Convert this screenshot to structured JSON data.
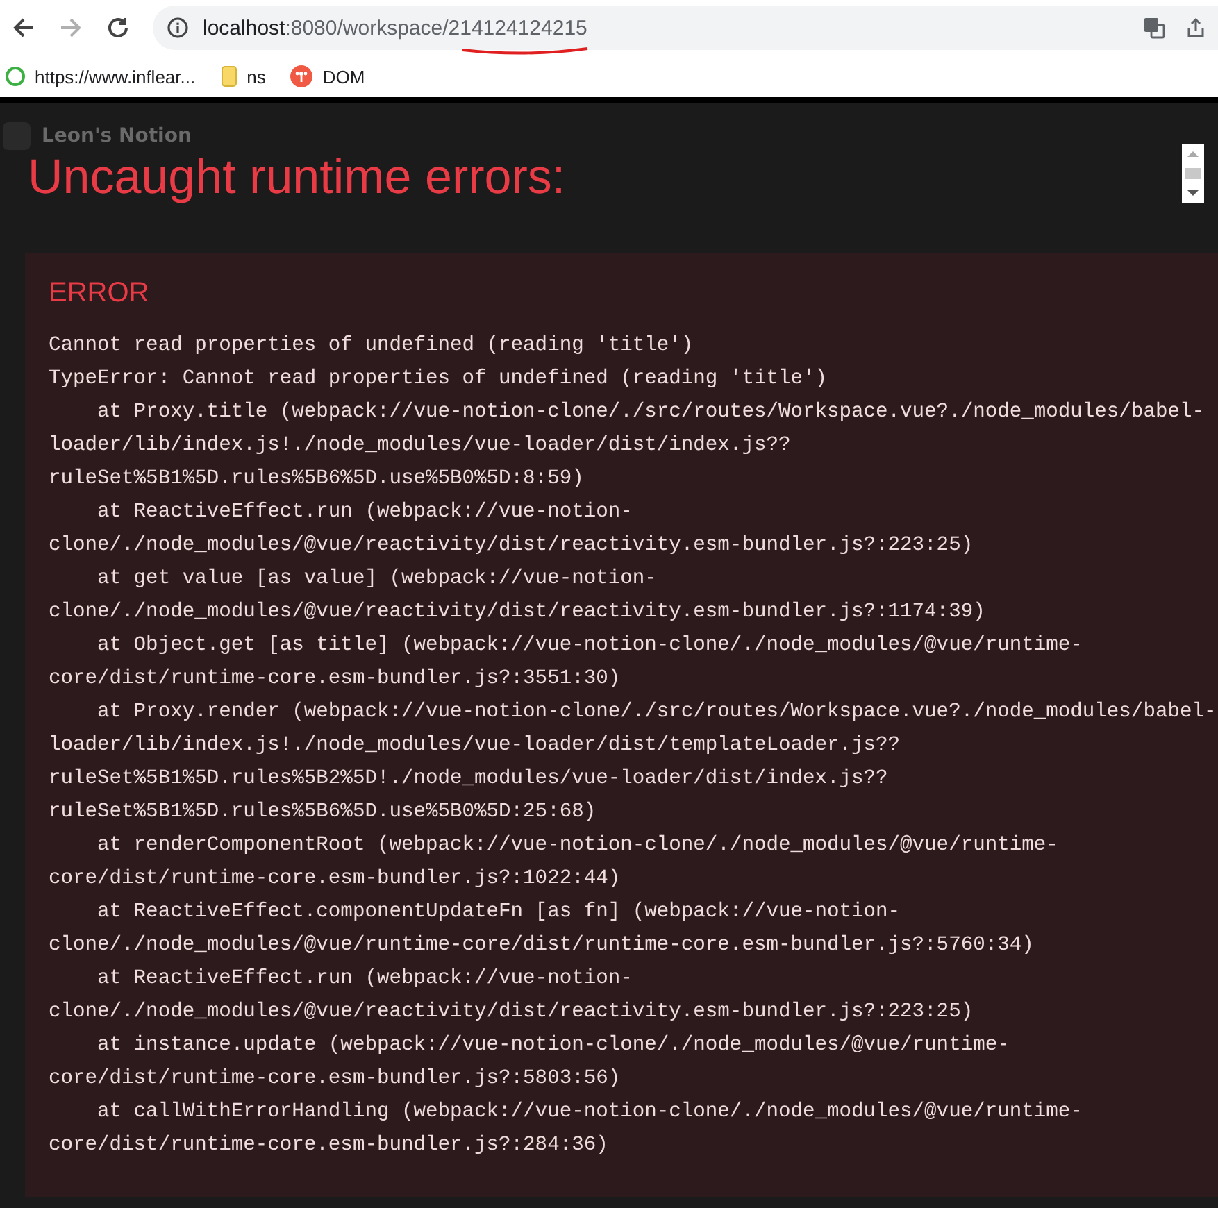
{
  "browser": {
    "nav": {
      "back_disabled": false,
      "forward_disabled": true
    },
    "url": {
      "host": "localhost",
      "rest": ":8080/workspace/",
      "highlight": "214124124215"
    },
    "bookmarks": [
      {
        "kind": "site",
        "label": "https://www.inflear..."
      },
      {
        "kind": "folder",
        "label": "ns"
      },
      {
        "kind": "app",
        "label": "DOM"
      }
    ]
  },
  "app": {
    "workspace_title": "Leon's Notion"
  },
  "overlay": {
    "title": "Uncaught runtime errors:",
    "error": {
      "heading": "ERROR",
      "lines": [
        "Cannot read properties of undefined (reading 'title')",
        "TypeError: Cannot read properties of undefined (reading 'title')",
        "    at Proxy.title (webpack://vue-notion-clone/./src/routes/Workspace.vue?./node_modules/babel-",
        "loader/lib/index.js!./node_modules/vue-loader/dist/index.js??",
        "ruleSet%5B1%5D.rules%5B6%5D.use%5B0%5D:8:59)",
        "    at ReactiveEffect.run (webpack://vue-notion-",
        "clone/./node_modules/@vue/reactivity/dist/reactivity.esm-bundler.js?:223:25)",
        "    at get value [as value] (webpack://vue-notion-",
        "clone/./node_modules/@vue/reactivity/dist/reactivity.esm-bundler.js?:1174:39)",
        "    at Object.get [as title] (webpack://vue-notion-clone/./node_modules/@vue/runtime-",
        "core/dist/runtime-core.esm-bundler.js?:3551:30)",
        "    at Proxy.render (webpack://vue-notion-clone/./src/routes/Workspace.vue?./node_modules/babel-",
        "loader/lib/index.js!./node_modules/vue-loader/dist/templateLoader.js??",
        "ruleSet%5B1%5D.rules%5B2%5D!./node_modules/vue-loader/dist/index.js??",
        "ruleSet%5B1%5D.rules%5B6%5D.use%5B0%5D:25:68)",
        "    at renderComponentRoot (webpack://vue-notion-clone/./node_modules/@vue/runtime-",
        "core/dist/runtime-core.esm-bundler.js?:1022:44)",
        "    at ReactiveEffect.componentUpdateFn [as fn] (webpack://vue-notion-",
        "clone/./node_modules/@vue/runtime-core/dist/runtime-core.esm-bundler.js?:5760:34)",
        "    at ReactiveEffect.run (webpack://vue-notion-",
        "clone/./node_modules/@vue/reactivity/dist/reactivity.esm-bundler.js?:223:25)",
        "    at instance.update (webpack://vue-notion-clone/./node_modules/@vue/runtime-",
        "core/dist/runtime-core.esm-bundler.js?:5803:56)",
        "    at callWithErrorHandling (webpack://vue-notion-clone/./node_modules/@vue/runtime-",
        "core/dist/runtime-core.esm-bundler.js?:284:36)"
      ]
    }
  }
}
